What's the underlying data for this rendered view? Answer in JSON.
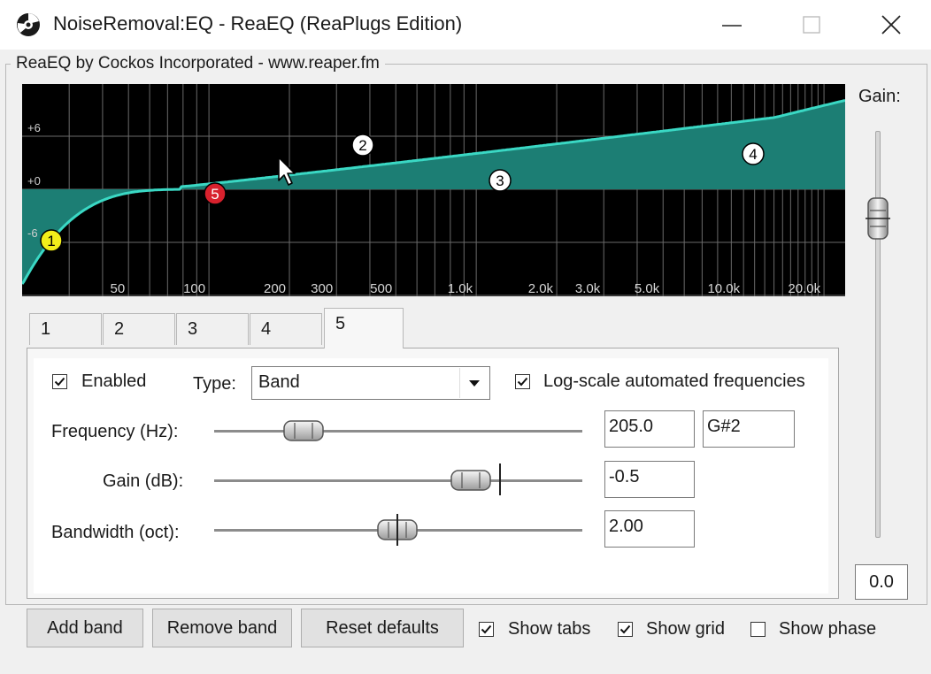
{
  "window": {
    "title": "NoiseRemoval:EQ - ReaEQ (ReaPlugs Edition)"
  },
  "group": {
    "label": "ReaEQ by Cockos Incorporated - www.reaper.fm"
  },
  "graph": {
    "db_labels": [
      "+6",
      "+0",
      "-6"
    ],
    "freq_labels": [
      "50",
      "100",
      "200",
      "300",
      "500",
      "1.0k",
      "2.0k",
      "3.0k",
      "5.0k",
      "10.0k",
      "20.0k"
    ],
    "band_nodes": [
      "1",
      "2",
      "3",
      "4",
      "5"
    ],
    "colors": {
      "background": "#000000",
      "curve": "#3ad8c4",
      "fill": "#1c7e74",
      "grid": "#6a6a6a",
      "node_1": "#f2ee1a",
      "node_5": "#d8212d",
      "node_default": "#ffffff"
    }
  },
  "gain": {
    "label": "Gain:",
    "value": "0.0"
  },
  "tabs": [
    "1",
    "2",
    "3",
    "4",
    "5"
  ],
  "active_tab": "5",
  "band": {
    "enabled_label": "Enabled",
    "enabled": true,
    "type_label": "Type:",
    "type_value": "Band",
    "logscale_label": "Log-scale automated frequencies",
    "logscale": true,
    "frequency_label": "Frequency (Hz):",
    "frequency_value": "205.0",
    "note_value": "G#2",
    "gain_label": "Gain (dB):",
    "gain_value": "-0.5",
    "bandwidth_label": "Bandwidth (oct):",
    "bandwidth_value": "2.00"
  },
  "buttons": {
    "add": "Add band",
    "remove": "Remove band",
    "reset": "Reset defaults"
  },
  "options": {
    "show_tabs_label": "Show tabs",
    "show_tabs": true,
    "show_grid_label": "Show grid",
    "show_grid": true,
    "show_phase_label": "Show phase",
    "show_phase": false
  }
}
